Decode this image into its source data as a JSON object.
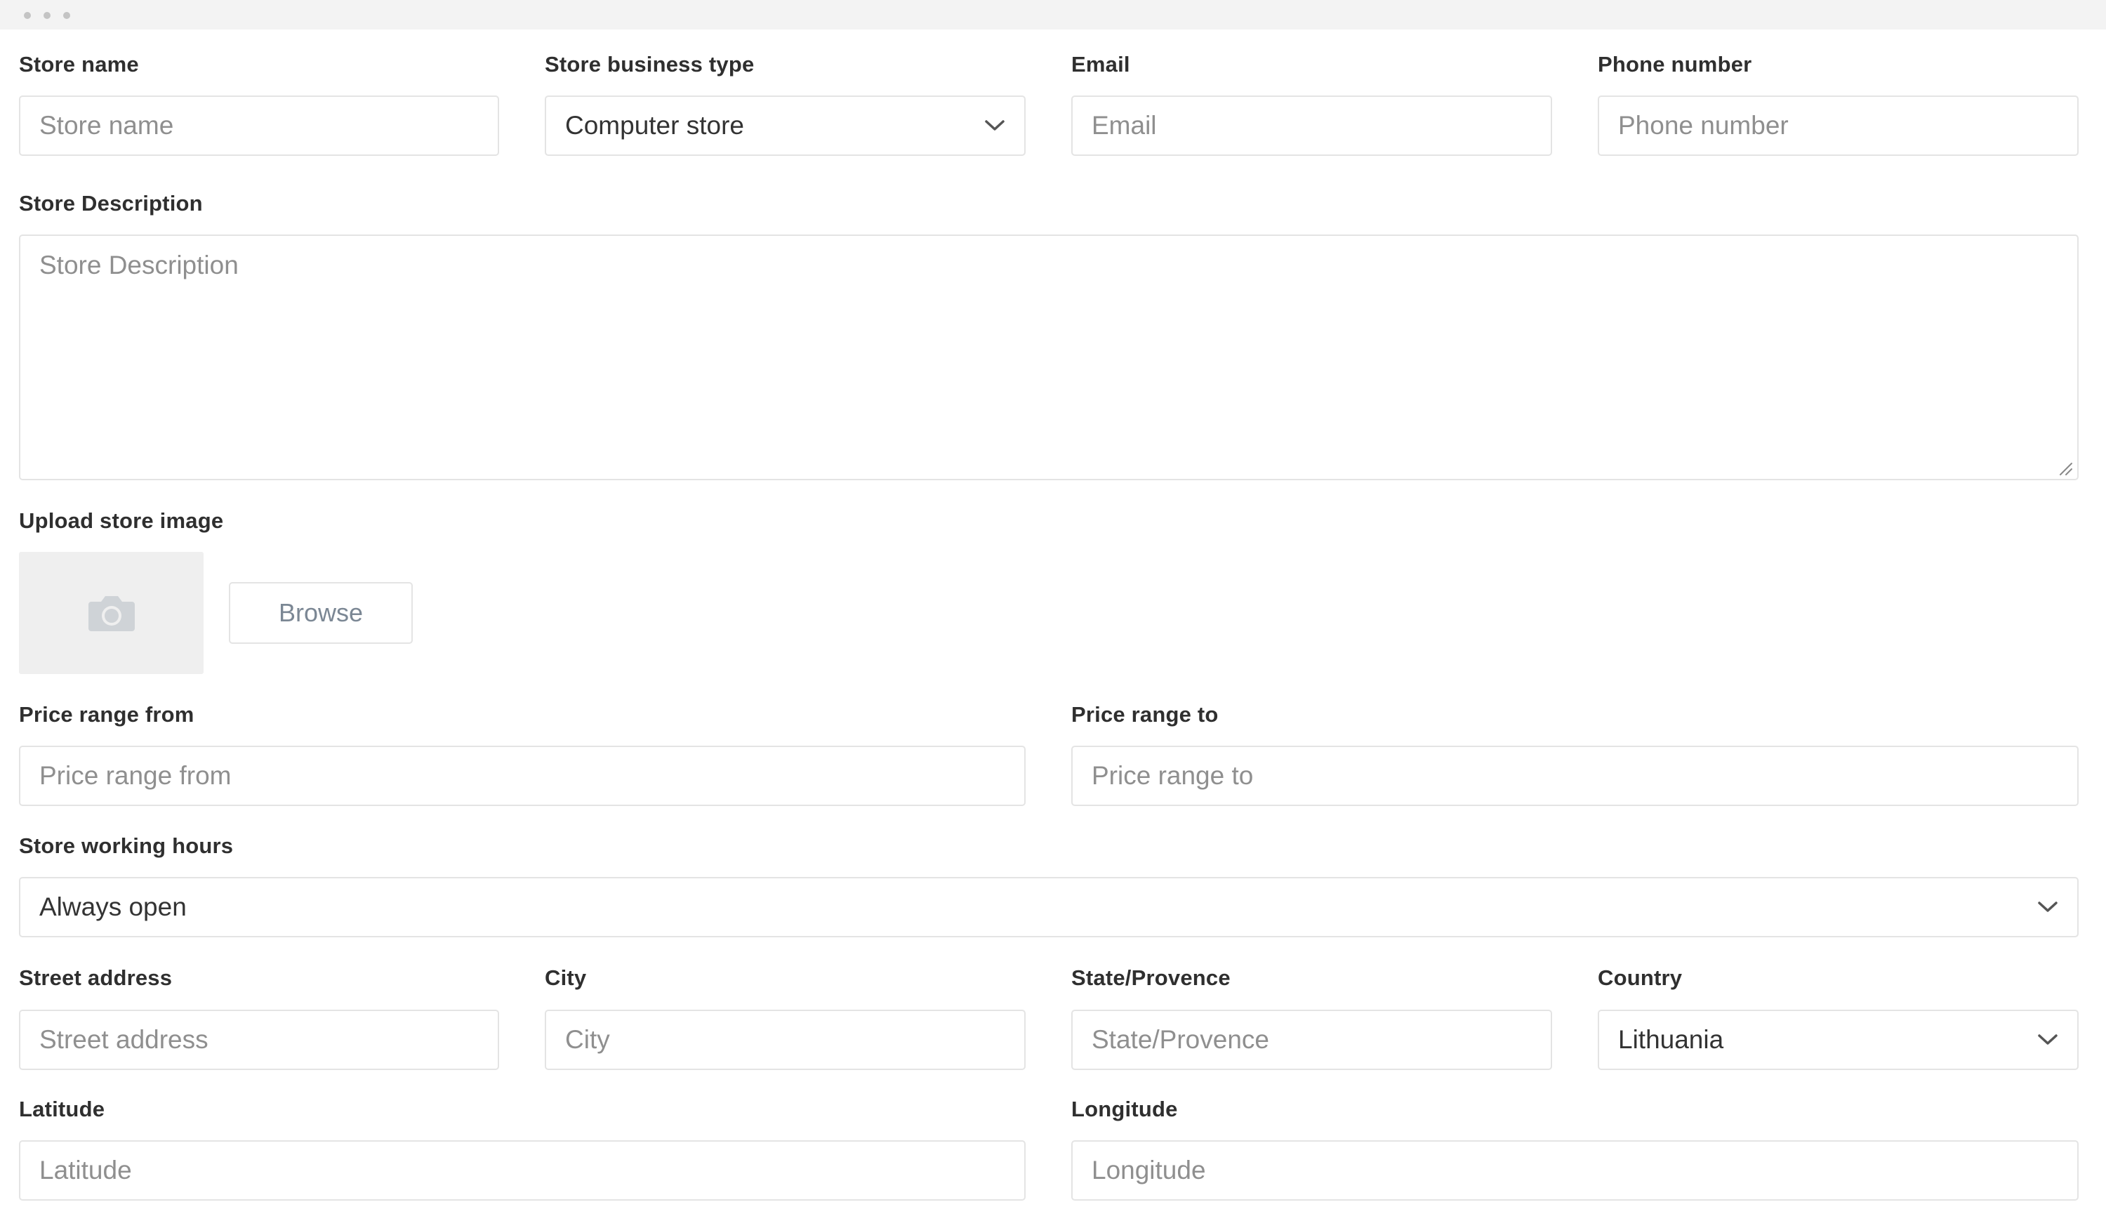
{
  "labels": {
    "store_name": "Store name",
    "business_type": "Store business type",
    "email": "Email",
    "phone": "Phone number",
    "description": "Store Description",
    "upload": "Upload store image",
    "price_from": "Price range from",
    "price_to": "Price range to",
    "working_hours": "Store working hours",
    "street": "Street address",
    "city": "City",
    "state": "State/Provence",
    "country": "Country",
    "latitude": "Latitude",
    "longitude": "Longitude"
  },
  "placeholders": {
    "store_name": "Store name",
    "email": "Email",
    "phone": "Phone number",
    "description": "Store Description",
    "price_from": "Price range from",
    "price_to": "Price range to",
    "street": "Street address",
    "city": "City",
    "state": "State/Provence",
    "latitude": "Latitude",
    "longitude": "Longitude"
  },
  "values": {
    "business_type": "Computer store",
    "working_hours": "Always open",
    "country": "Lithuania"
  },
  "buttons": {
    "browse": "Browse"
  },
  "icons": {
    "upload_placeholder": "camera-icon",
    "dropdown": "chevron-down-icon"
  },
  "colors": {
    "label": "#2f2f2f",
    "placeholder": "#8f8f8f",
    "border": "#e4e4e4",
    "image_box": "#efefef"
  }
}
